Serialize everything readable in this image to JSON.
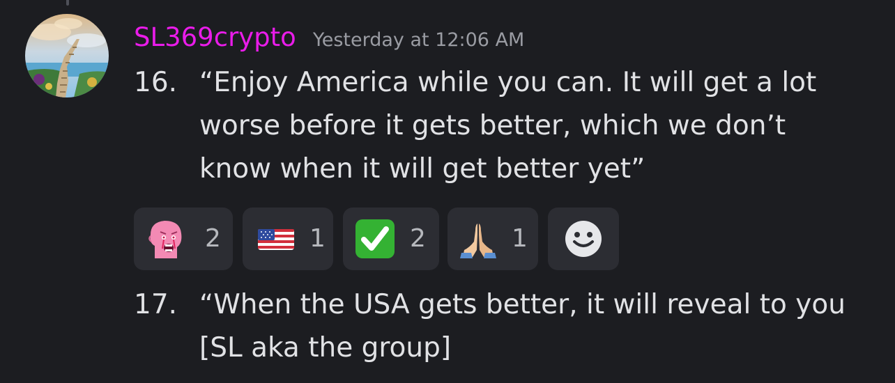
{
  "message": {
    "author": "SL369crypto",
    "timestamp": "Yesterday at 12:06 AM",
    "author_color": "#e91ce9",
    "avatar": "stairway-to-heaven-avatar",
    "items": [
      {
        "number": "16.",
        "lines": [
          "“Enjoy America while you can. It will get a lot",
          "worse before it gets better, which we don’t",
          "know when it will get better yet”"
        ]
      },
      {
        "number": "17.",
        "lines": [
          "“When the USA gets better, it will reveal to you",
          "[SL aka the group]"
        ]
      }
    ],
    "reactions": [
      {
        "emoji": "pink-crying-wojak-emoji",
        "count": "2"
      },
      {
        "emoji": "us-flag-emoji",
        "count": "1"
      },
      {
        "emoji": "check-mark-button-emoji",
        "count": "2"
      },
      {
        "emoji": "folded-hands-emoji",
        "count": "1"
      }
    ],
    "add_reaction": "add-reaction-smiley-icon"
  }
}
